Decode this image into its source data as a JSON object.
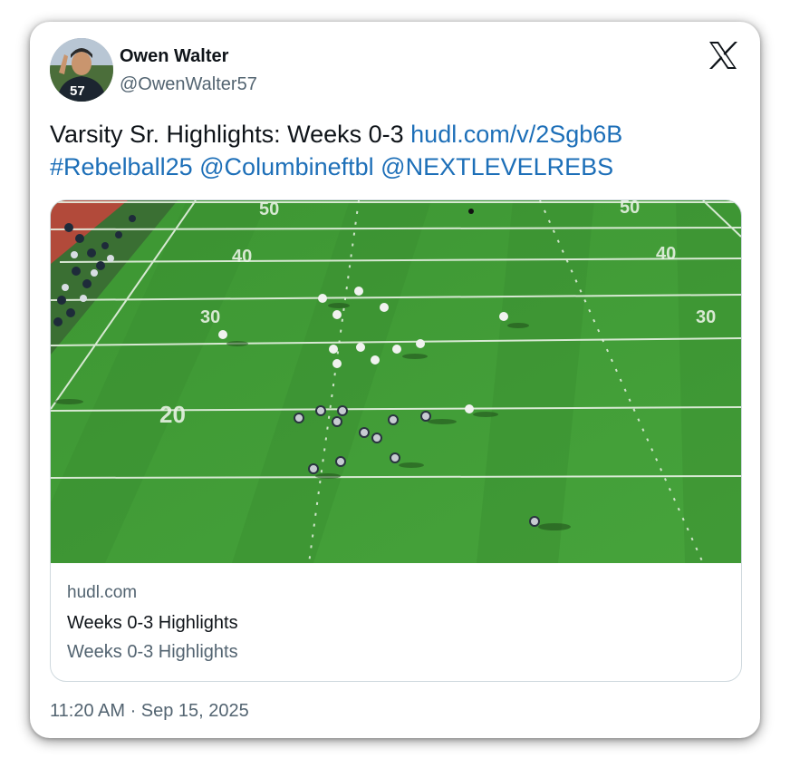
{
  "author": {
    "display_name": "Owen Walter",
    "handle": "@OwenWalter57",
    "jersey_number": "57"
  },
  "tweet": {
    "text_prefix": "Varsity Sr. Highlights: Weeks 0-3 ",
    "link": "hudl.com/v/2Sgb6B",
    "hashtag": "#Rebelball25",
    "mention_1": "@Columbineftbl",
    "mention_2": "@NEXTLEVELREBS"
  },
  "link_card": {
    "domain": "hudl.com",
    "title": "Weeks 0-3 Highlights",
    "description": "Weeks 0-3 Highlights",
    "field_numbers": [
      "50",
      "40",
      "30",
      "20",
      "30",
      "40",
      "50"
    ]
  },
  "timestamp": "11:20 AM · Sep 15, 2025",
  "icons": {
    "platform_logo": "x-logo-icon"
  },
  "colors": {
    "link": "#1d6fb8",
    "text": "#0f1419",
    "secondary_text": "#536471",
    "field_green": "#3f9a36"
  }
}
